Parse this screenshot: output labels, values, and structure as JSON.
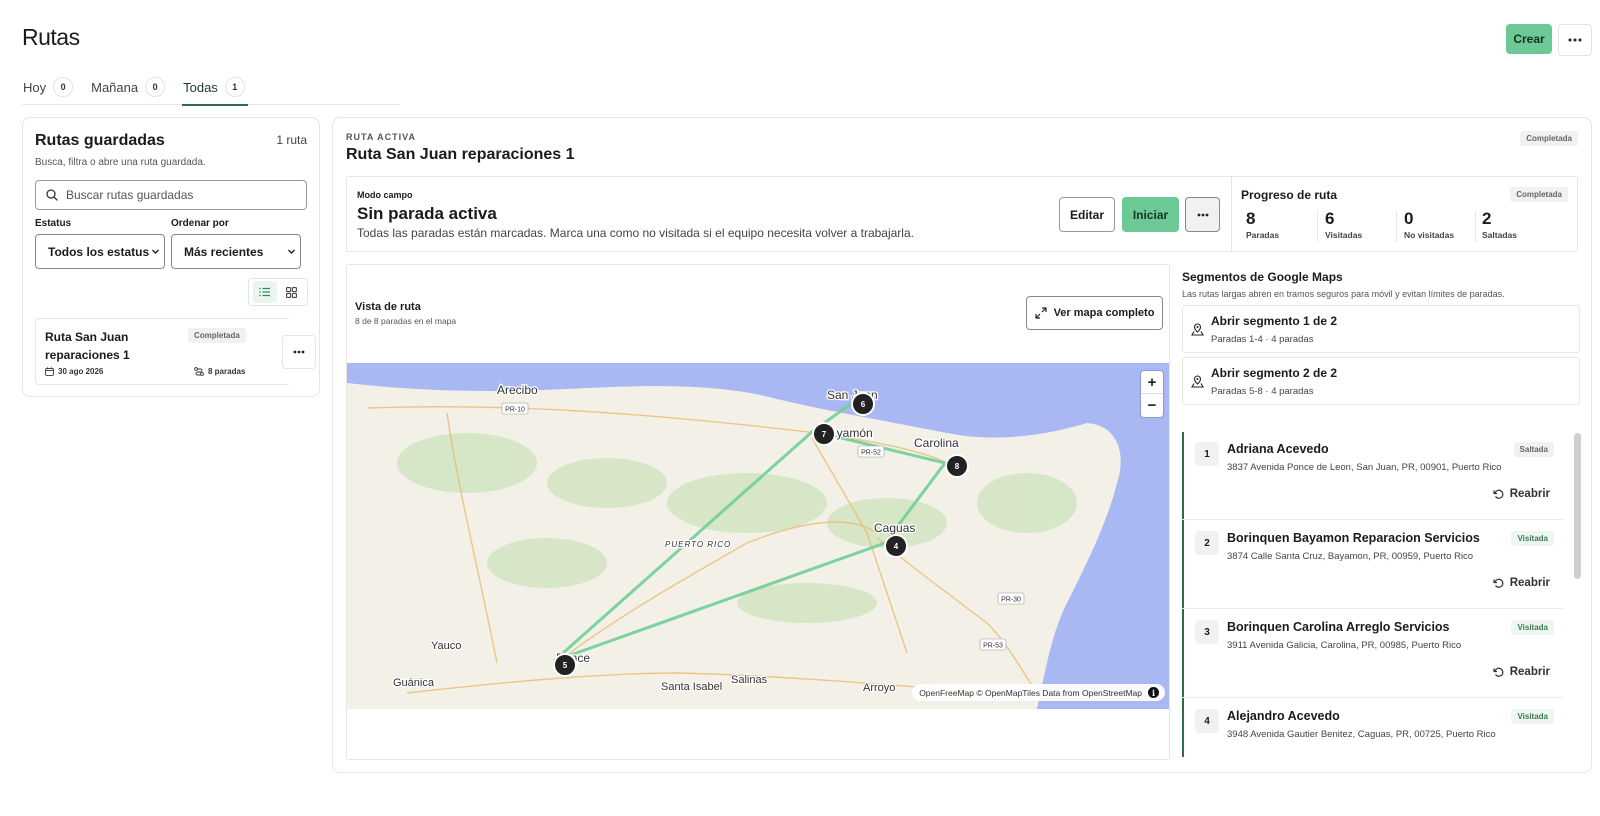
{
  "header": {
    "title": "Rutas",
    "create_label": "Crear"
  },
  "tabs": [
    {
      "label": "Hoy",
      "count": "0"
    },
    {
      "label": "Mañana",
      "count": "0"
    },
    {
      "label": "Todas",
      "count": "1"
    }
  ],
  "saved": {
    "title": "Rutas guardadas",
    "count": "1 ruta",
    "subtitle": "Busca, filtra o abre una ruta guardada.",
    "search_placeholder": "Buscar rutas guardadas",
    "status_label": "Estatus",
    "status_value": "Todos los estatus",
    "sort_label": "Ordenar por",
    "sort_value": "Más recientes",
    "card": {
      "name": "Ruta San Juan reparaciones 1",
      "badge": "Completada",
      "date": "30 ago 2026",
      "stops": "8 paradas"
    }
  },
  "active": {
    "eyebrow": "RUTA ACTIVA",
    "title": "Ruta San Juan reparaciones 1",
    "badge": "Completada",
    "field_mode": {
      "eyebrow": "Modo campo",
      "title": "Sin parada activa",
      "subtitle": "Todas las paradas están marcadas. Marca una como no visitada si el equipo necesita volver a trabajarla.",
      "edit_label": "Editar",
      "start_label": "Iniciar"
    },
    "progress": {
      "title": "Progreso de ruta",
      "badge": "Completada",
      "stats": [
        {
          "value": "8",
          "label": "Paradas"
        },
        {
          "value": "6",
          "label": "Visitadas"
        },
        {
          "value": "0",
          "label": "No visitadas"
        },
        {
          "value": "2",
          "label": "Saltadas"
        }
      ]
    },
    "map_card": {
      "title": "Vista de ruta",
      "subtitle": "8 de 8 paradas en el mapa",
      "full_map_label": "Ver mapa completo",
      "attribution": "OpenFreeMap © OpenMapTiles Data from OpenStreetMap",
      "zoom_in": "+",
      "zoom_out": "−",
      "places": [
        "Arecibo",
        "San Juan",
        "Bayamón",
        "Carolina",
        "Caguas",
        "PUERTO RICO",
        "Yauco",
        "Ponce",
        "Guánica",
        "Santa Isabel",
        "Salinas",
        "Arroyo"
      ],
      "roads": [
        "PR-10",
        "PR-52",
        "PR-30",
        "PR-53"
      ],
      "markers": [
        "6",
        "7",
        "8",
        "4",
        "5"
      ]
    },
    "segments": {
      "title": "Segmentos de Google Maps",
      "subtitle": "Las rutas largas abren en tramos seguros para móvil y evitan límites de paradas.",
      "items": [
        {
          "title": "Abrir segmento 1 de 2",
          "sub": "Paradas 1-4 · 4 paradas"
        },
        {
          "title": "Abrir segmento 2 de 2",
          "sub": "Paradas 5-8 · 4 paradas"
        }
      ]
    },
    "reopen_label": "Reabrir",
    "stops": [
      {
        "num": "1",
        "name": "Adriana Acevedo",
        "address": "3837 Avenida Ponce de Leon, San Juan, PR, 00901, Puerto Rico",
        "status": "Saltada"
      },
      {
        "num": "2",
        "name": "Borinquen Bayamon Reparacion Servicios",
        "address": "3874 Calle Santa Cruz, Bayamon, PR, 00959, Puerto Rico",
        "status": "Visitada"
      },
      {
        "num": "3",
        "name": "Borinquen Carolina Arreglo Servicios",
        "address": "3911 Avenida Galicia, Carolina, PR, 00985, Puerto Rico",
        "status": "Visitada"
      },
      {
        "num": "4",
        "name": "Alejandro Acevedo",
        "address": "3948 Avenida Gautier Benitez, Caguas, PR, 00725, Puerto Rico",
        "status": "Visitada"
      }
    ]
  },
  "colors": {
    "accent": "#6cc894",
    "accent_dark": "#2f6a4c",
    "ocean": "#a9b8f2",
    "land": "#f3f0e8",
    "route_line": "#6fcf97"
  }
}
